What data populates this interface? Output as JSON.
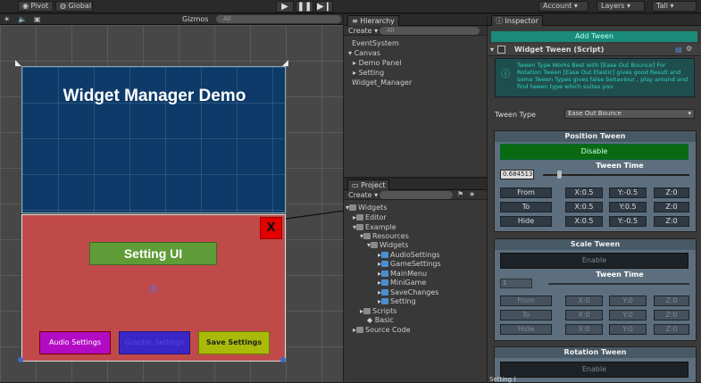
{
  "toolbar": {
    "pivot": "Pivot",
    "global": "Global",
    "account": "Account",
    "layers": "Layers",
    "layout": "Tall"
  },
  "scene": {
    "gizmos": "Gizmos",
    "search_placeholder": "All",
    "title": "Widget Manager Demo",
    "setting_ui": "Setting UI",
    "close": "X",
    "audio_settings": "Audio Settings",
    "graphics_settings": "Graphic Settings",
    "save_settings": "Save Settings"
  },
  "hierarchy": {
    "tab": "Hierarchy",
    "create": "Create",
    "search_placeholder": "All",
    "items": [
      "EventSystem",
      "Canvas",
      "Demo Panel",
      "Setting",
      "Widget_Manager"
    ]
  },
  "project": {
    "tab": "Project",
    "create": "Create",
    "items": [
      "Widgets",
      "Editor",
      "Example",
      "Resources",
      "Widgets",
      "AudioSettings",
      "GameSettings",
      "MainMenu",
      "MiniGame",
      "SaveChanges",
      "Setting",
      "Scripts",
      "Basic",
      "Source Code"
    ]
  },
  "inspector": {
    "tab": "Inspector",
    "add_tween": "Add Tween",
    "component": "Widget Tween (Script)",
    "help": "Tween Type Works Best with [Ease Out Bounce] For Rotation Tween [Ease Out Elastic] gives good Result and some Tween Types gives false behaviour , play around and find tween type which suites you",
    "tween_type_label": "Tween Type",
    "tween_type_value": "Ease Out Bounce",
    "position": {
      "title": "Position Tween",
      "toggle": "Disable",
      "time_label": "Tween Time",
      "time_value": "0.684513",
      "rows": [
        {
          "label": "From",
          "x": "X:0.5",
          "y": "Y:-0.5",
          "z": "Z:0"
        },
        {
          "label": "To",
          "x": "X:0.5",
          "y": "Y:0.5",
          "z": "Z:0"
        },
        {
          "label": "Hide",
          "x": "X:0.5",
          "y": "Y:-0.5",
          "z": "Z:0"
        }
      ]
    },
    "scale": {
      "title": "Scale Tween",
      "toggle": "Enable",
      "time_label": "Tween Time",
      "time_value": "1",
      "rows": [
        {
          "label": "From",
          "x": "X:0",
          "y": "Y:0",
          "z": "Z:0"
        },
        {
          "label": "To",
          "x": "X:0",
          "y": "Y:0",
          "z": "Z:0"
        },
        {
          "label": "Hide",
          "x": "X:0",
          "y": "Y:0",
          "z": "Z:0"
        }
      ]
    },
    "rotation": {
      "title": "Rotation Tween",
      "toggle": "Enable"
    },
    "footer": "Setting ("
  }
}
